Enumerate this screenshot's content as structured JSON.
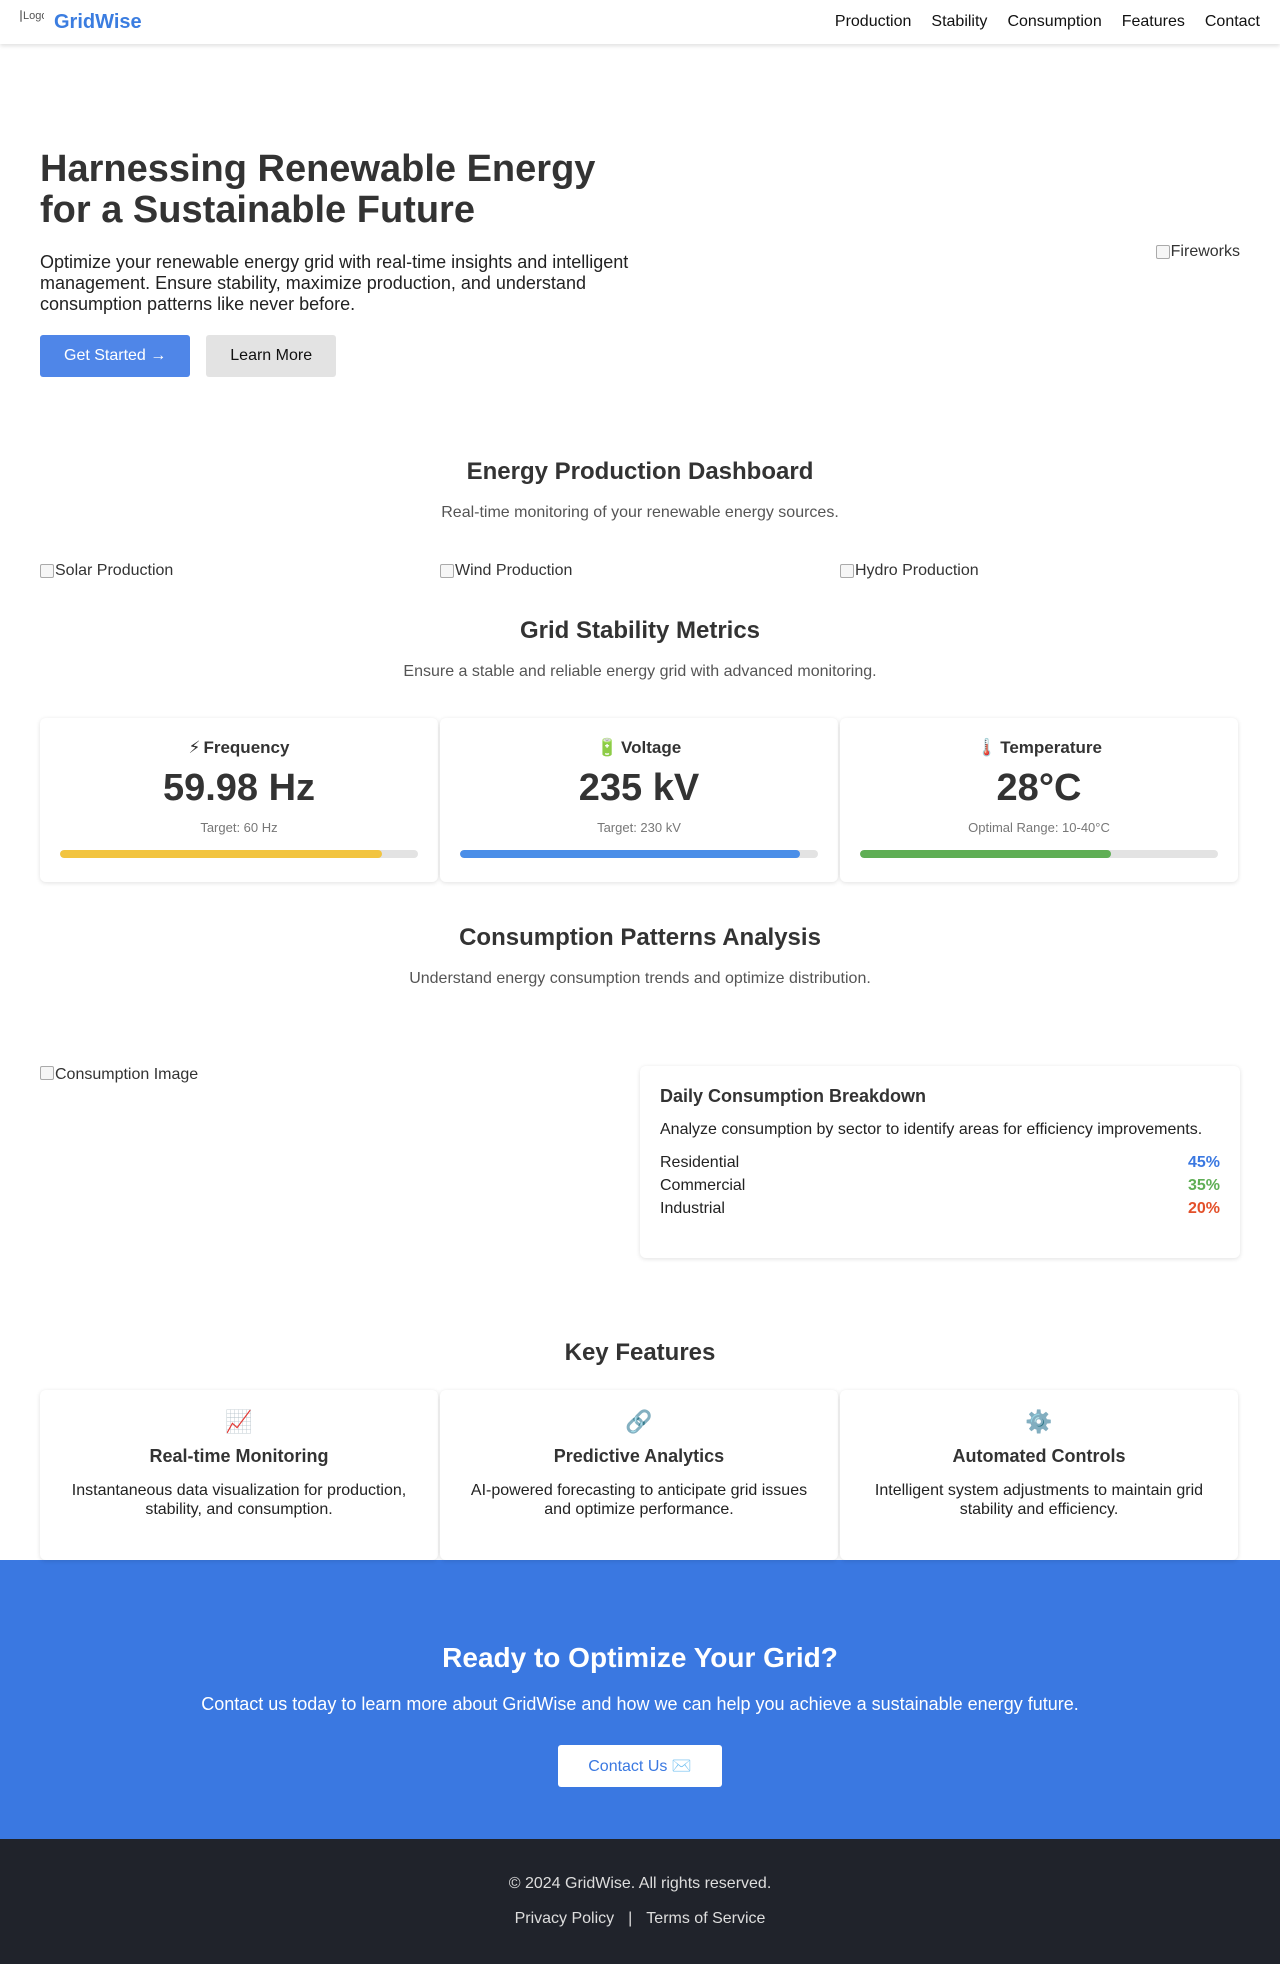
{
  "nav": {
    "logo_alt": "Logo",
    "brand": "GridWise",
    "links": [
      "Production",
      "Stability",
      "Consumption",
      "Features",
      "Contact"
    ]
  },
  "hero": {
    "title": "Harnessing Renewable Energy for a Sustainable Future",
    "subtitle": "Optimize your renewable energy grid with real-time insights and intelligent management. Ensure stability, maximize production, and understand consumption patterns like never before.",
    "primary_button": "Get Started →",
    "secondary_button": "Learn More",
    "image_alt": "Fireworks"
  },
  "production": {
    "title": "Energy Production Dashboard",
    "subtitle": "Real-time monitoring of your renewable energy sources.",
    "images": [
      "Solar Production",
      "Wind Production",
      "Hydro Production"
    ]
  },
  "stability": {
    "title": "Grid Stability Metrics",
    "subtitle": "Ensure a stable and reliable energy grid with advanced monitoring.",
    "metrics": [
      {
        "icon": "⚡",
        "icon_name": "lightning-icon",
        "name": "Frequency",
        "value": "59.98 Hz",
        "target": "Target: 60 Hz",
        "progress": 0.9,
        "color": "#f2c440"
      },
      {
        "icon": "🔋",
        "icon_name": "battery-icon",
        "name": "Voltage",
        "value": "235 kV",
        "target": "Target: 230 kV",
        "progress": 0.95,
        "color": "#4a8ee8"
      },
      {
        "icon": "🌡️",
        "icon_name": "thermometer-icon",
        "name": "Temperature",
        "value": "28°C",
        "target": "Optimal Range: 10-40°C",
        "progress": 0.7,
        "color": "#5fae55"
      }
    ]
  },
  "consumption": {
    "title": "Consumption Patterns Analysis",
    "subtitle": "Understand energy consumption trends and optimize distribution.",
    "image_alt": "Consumption Image",
    "card": {
      "title": "Daily Consumption Breakdown",
      "description": "Analyze consumption by sector to identify areas for efficiency improvements.",
      "rows": [
        {
          "label": "Residential",
          "value": "45%",
          "color": "#3a78e1"
        },
        {
          "label": "Commercial",
          "value": "35%",
          "color": "#5fae55"
        },
        {
          "label": "Industrial",
          "value": "20%",
          "color": "#e3502a"
        }
      ]
    }
  },
  "features": {
    "title": "Key Features",
    "items": [
      {
        "icon": "📈",
        "icon_name": "chart-increasing-icon",
        "title": "Real-time Monitoring",
        "description": "Instantaneous data visualization for production, stability, and consumption."
      },
      {
        "icon": "🔗",
        "icon_name": "link-icon",
        "title": "Predictive Analytics",
        "description": "AI-powered forecasting to anticipate grid issues and optimize performance."
      },
      {
        "icon": "⚙️",
        "icon_name": "gear-icon",
        "title": "Automated Controls",
        "description": "Intelligent system adjustments to maintain grid stability and efficiency."
      }
    ]
  },
  "cta": {
    "title": "Ready to Optimize Your Grid?",
    "subtitle": "Contact us today to learn more about GridWise and how we can help you achieve a sustainable energy future.",
    "button": "Contact Us ✉️"
  },
  "footer": {
    "copyright": "© 2024 GridWise. All rights reserved.",
    "links": [
      "Privacy Policy",
      "Terms of Service"
    ],
    "separator": "|"
  },
  "colors": {
    "brand": "#3b7de0",
    "primary_button": "#4f86e8",
    "cta_background": "#3a78e1",
    "footer_background": "#20232b"
  }
}
